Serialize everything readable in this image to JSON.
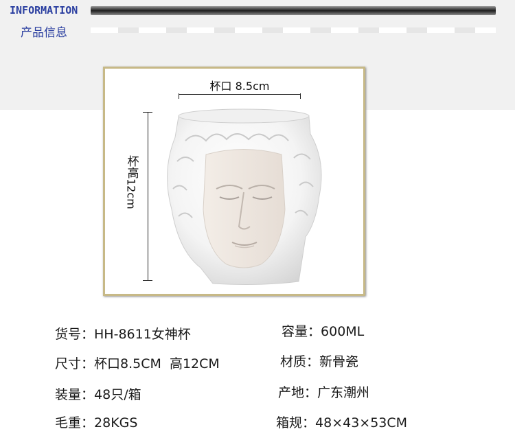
{
  "header": {
    "title_en": "INFORMATION",
    "title_cn": "产品信息"
  },
  "dimensions": {
    "mouth": "杯口 8.5cm",
    "height_label_cn": "杯高",
    "height_value": "12cm"
  },
  "specs": {
    "item_no": {
      "label": "货号：",
      "value": "HH-8611女神杯"
    },
    "capacity": {
      "label": "容量：",
      "value": "600ML"
    },
    "size": {
      "label": "尺寸：",
      "value": "杯口8.5CM  高12CM"
    },
    "material": {
      "label": "材质：",
      "value": "新骨瓷"
    },
    "packing": {
      "label": "装量：",
      "value": "48只/箱"
    },
    "origin": {
      "label": "产地：",
      "value": "广东潮州"
    },
    "gross_weight": {
      "label": "毛重：",
      "value": "28KGS"
    },
    "carton_size": {
      "label": "箱规：",
      "value": "48×43×53CM"
    }
  },
  "colors": {
    "accent": "#2a3ea0",
    "frame": "#c7b987"
  },
  "icons": {
    "product": "goddess-head-mug-image"
  }
}
